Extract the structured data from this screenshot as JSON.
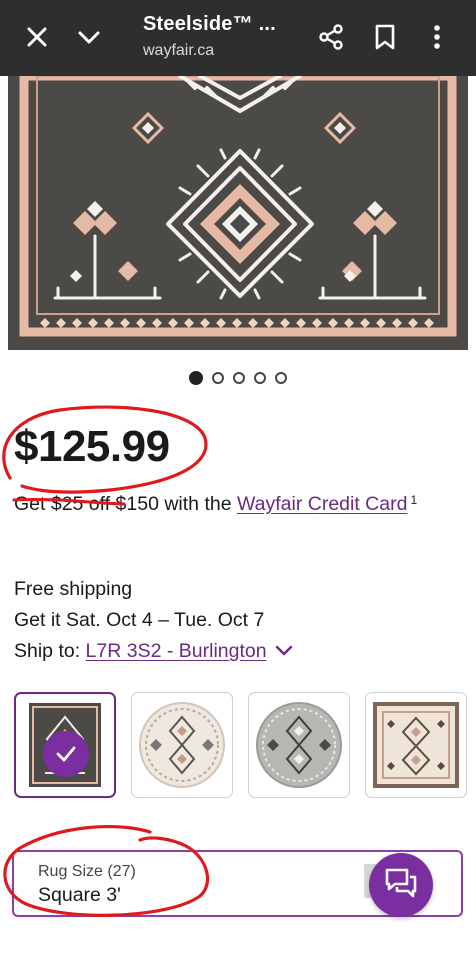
{
  "browser": {
    "title": "Steelside™ ...",
    "url": "wayfair.ca",
    "icons": [
      "close-icon",
      "chevron-down-icon",
      "share-icon",
      "bookmark-icon",
      "more-vert-icon"
    ]
  },
  "carousel": {
    "total": 5,
    "active": 1
  },
  "product": {
    "price": "$125.99",
    "credit_prefix": "Get $25 off $150 with the ",
    "credit_link": "Wayfair Credit Card",
    "credit_footnote": "1"
  },
  "shipping": {
    "line1": "Free shipping",
    "line2": "Get it Sat. Oct 4 – Tue. Oct 7",
    "ship_to_label": "Ship to: ",
    "ship_to_link": "L7R 3S2 - Burlington"
  },
  "swatches": {
    "selected_index": 0,
    "items": [
      "dark charcoal rectangular rug",
      "cream round rug",
      "grey round rug",
      "beige square rug"
    ]
  },
  "rug_size": {
    "label": "Rug Size (27)",
    "value": "Square 3'"
  },
  "colors": {
    "topbar": "#2e2e2e",
    "brand_purple": "#7b2ea0",
    "link_purple": "#6b2a83",
    "annotation_red": "#e0191e",
    "rug_charcoal": "#4b4a47",
    "rug_peach": "#e6b9a5"
  }
}
